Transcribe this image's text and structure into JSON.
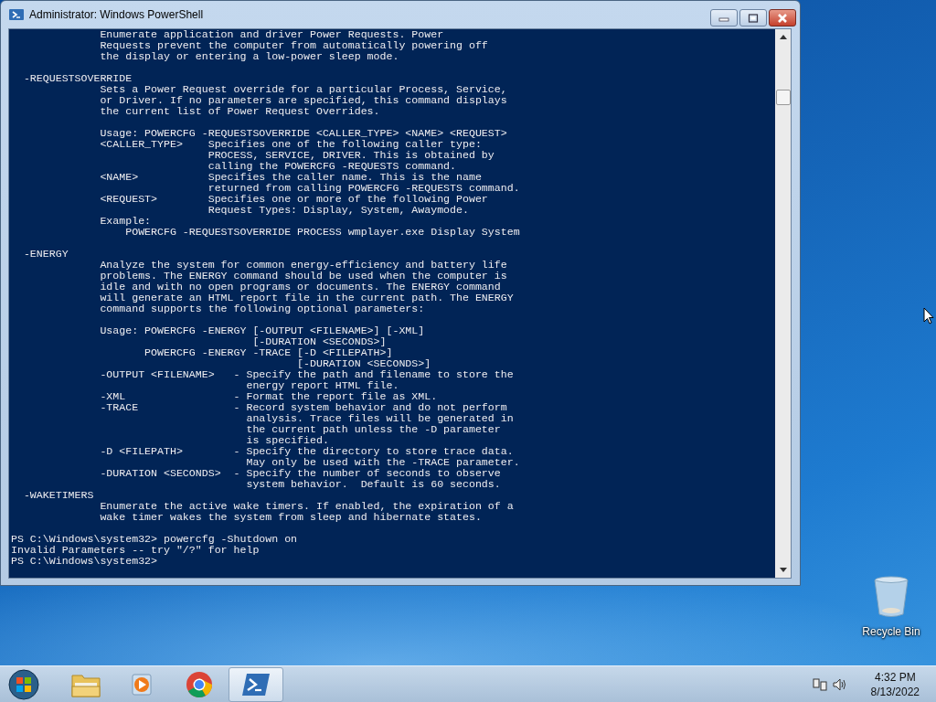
{
  "window": {
    "title": "Administrator: Windows PowerShell",
    "output_blocks": [
      {
        "lines": [
          "              Enumerate application and driver Power Requests. Power",
          "              Requests prevent the computer from automatically powering off",
          "              the display or entering a low-power sleep mode."
        ]
      },
      {
        "lines": [
          "  -REQUESTSOVERRIDE",
          "              Sets a Power Request override for a particular Process, Service,",
          "              or Driver. If no parameters are specified, this command displays",
          "              the current list of Power Request Overrides."
        ]
      },
      {
        "lines": [
          "              Usage: POWERCFG -REQUESTSOVERRIDE <CALLER_TYPE> <NAME> <REQUEST>",
          "              <CALLER_TYPE>    Specifies one of the following caller type:",
          "                               PROCESS, SERVICE, DRIVER. This is obtained by",
          "                               calling the POWERCFG -REQUESTS command.",
          "              <NAME>           Specifies the caller name. This is the name",
          "                               returned from calling POWERCFG -REQUESTS command.",
          "              <REQUEST>        Specifies one or more of the following Power",
          "                               Request Types: Display, System, Awaymode.",
          "              Example:",
          "                  POWERCFG -REQUESTSOVERRIDE PROCESS wmplayer.exe Display System"
        ]
      },
      {
        "lines": [
          "  -ENERGY",
          "              Analyze the system for common energy-efficiency and battery life",
          "              problems. The ENERGY command should be used when the computer is",
          "              idle and with no open programs or documents. The ENERGY command",
          "              will generate an HTML report file in the current path. The ENERGY",
          "              command supports the following optional parameters:"
        ]
      },
      {
        "lines": [
          "              Usage: POWERCFG -ENERGY [-OUTPUT <FILENAME>] [-XML]",
          "                                      [-DURATION <SECONDS>]",
          "                     POWERCFG -ENERGY -TRACE [-D <FILEPATH>]",
          "                                             [-DURATION <SECONDS>]",
          "              -OUTPUT <FILENAME>   - Specify the path and filename to store the",
          "                                     energy report HTML file.",
          "              -XML                 - Format the report file as XML.",
          "              -TRACE               - Record system behavior and do not perform",
          "                                     analysis. Trace files will be generated in",
          "                                     the current path unless the -D parameter",
          "                                     is specified.",
          "              -D <FILEPATH>        - Specify the directory to store trace data.",
          "                                     May only be used with the -TRACE parameter.",
          "              -DURATION <SECONDS>  - Specify the number of seconds to observe",
          "                                     system behavior.  Default is 60 seconds.",
          "  -WAKETIMERS",
          "              Enumerate the active wake timers. If enabled, the expiration of a",
          "              wake timer wakes the system from sleep and hibernate states."
        ]
      }
    ],
    "session": [
      "PS C:\\Windows\\system32> powercfg -Shutdown on",
      "Invalid Parameters -- try \"/?\" for help",
      "PS C:\\Windows\\system32>"
    ]
  },
  "desktop": {
    "icons": [
      {
        "label": "Recycle Bin"
      }
    ]
  },
  "taskbar": {
    "apps": [
      {
        "kind": "folder",
        "selected": false
      },
      {
        "kind": "media",
        "selected": false
      },
      {
        "kind": "chrome",
        "selected": false
      },
      {
        "kind": "powershell",
        "selected": true
      }
    ],
    "clock": {
      "time": "4:32 PM",
      "date": "8/13/2022"
    }
  }
}
